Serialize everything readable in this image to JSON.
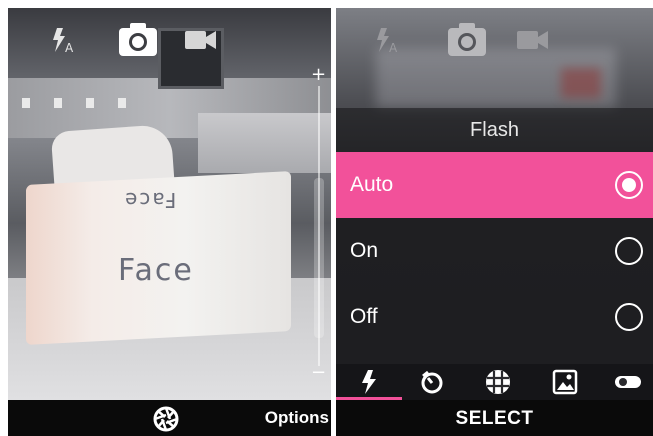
{
  "left_screen": {
    "icons": {
      "flash": "flash-auto-icon",
      "photo": "camera-icon",
      "video": "video-camera-icon"
    },
    "zoom": {
      "plus": "+",
      "minus": "−",
      "level": 0.45
    },
    "scene": {
      "brand_main": "Face",
      "brand_top": "Face"
    },
    "bottom_bar": {
      "shutter_icon": "aperture-icon",
      "options_label": "Options"
    }
  },
  "right_screen": {
    "icons": {
      "flash": "flash-auto-icon",
      "photo": "camera-icon",
      "video": "video-camera-icon"
    },
    "menu": {
      "title": "Flash",
      "items": [
        {
          "label": "Auto",
          "selected": true
        },
        {
          "label": "On",
          "selected": false
        },
        {
          "label": "Off",
          "selected": false
        }
      ]
    },
    "tabs": [
      "flash-icon",
      "timer-icon",
      "grid-icon",
      "image-icon",
      "toggle-icon"
    ],
    "select_label": "SELECT"
  },
  "colors": {
    "accent": "#f2519a",
    "bar": "#0a0a0a",
    "text": "#ffffff"
  }
}
